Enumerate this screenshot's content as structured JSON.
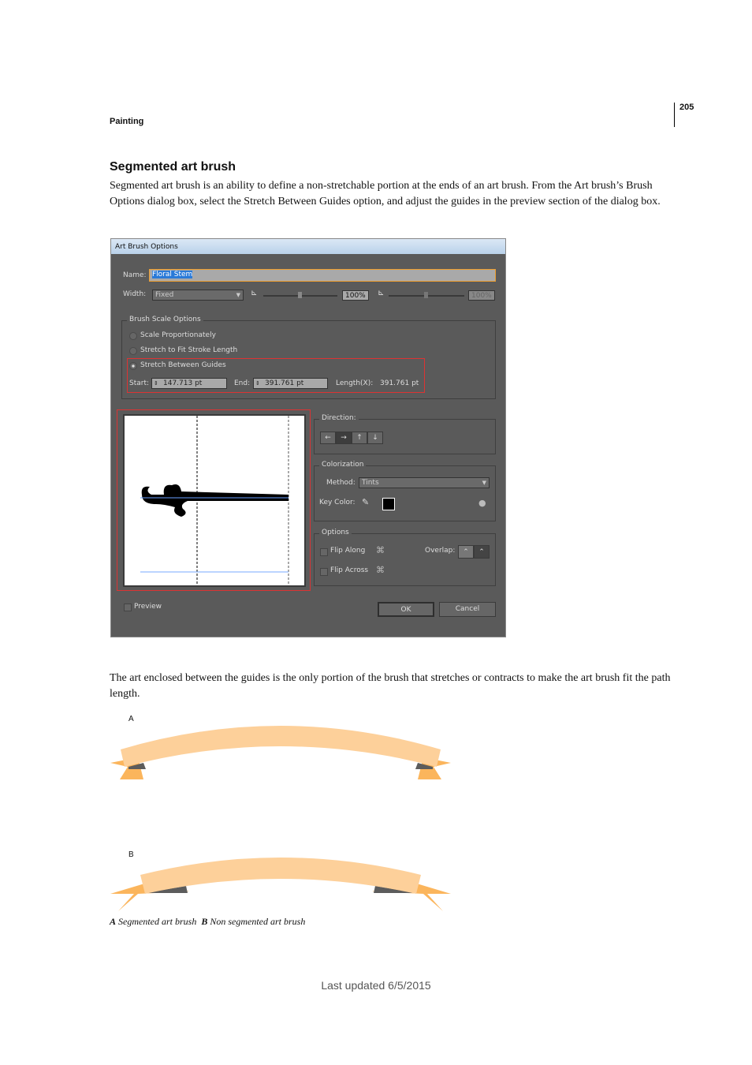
{
  "header": {
    "section": "Painting",
    "page_number": "205"
  },
  "heading": "Segmented art brush",
  "intro": "Segmented art brush is an ability to define a non-stretchable portion at the ends of an art brush. From the Art brush’s Brush Options dialog box, select the Stretch Between Guides option, and adjust the guides in the preview section of the dialog box.",
  "dialog": {
    "title": "Art Brush Options",
    "name_label": "Name:",
    "name_value": "Floral Stem",
    "width_label": "Width:",
    "width_value": "Fixed",
    "slider1_value": "100%",
    "slider2_value": "100%",
    "scale_group": "Brush Scale Options",
    "opt_scale": "Scale Proportionately",
    "opt_stretch": "Stretch to Fit Stroke Length",
    "opt_guides": "Stretch Between Guides",
    "selected_option": "Stretch Between Guides",
    "start_label": "Start:",
    "start_value": "147.713 pt",
    "end_label": "End:",
    "end_value": "391.761 pt",
    "length_label": "Length(X):",
    "length_value": "391.761 pt",
    "direction_label": "Direction:",
    "colorization_label": "Colorization",
    "method_label": "Method:",
    "method_value": "Tints",
    "key_color_label": "Key Color:",
    "key_color": "#000000",
    "options_label": "Options",
    "flip_along": "Flip Along",
    "flip_across": "Flip Across",
    "overlap_label": "Overlap:",
    "preview_label": "Preview",
    "ok": "OK",
    "cancel": "Cancel"
  },
  "para2": "The art enclosed between the guides is the only portion of the brush that stretches or contracts to make the art brush fit the path length.",
  "figure": {
    "label_a": "A",
    "label_b": "B",
    "caption_a_letter": "A",
    "caption_a": "Segmented art brush",
    "caption_b_letter": "B",
    "caption_b": "Non segmented art brush",
    "ribbon_color": "#fdd09a",
    "tail_color": "#fbb55c",
    "shadow_color": "#5c5c5c"
  },
  "footer": "Last updated 6/5/2015"
}
